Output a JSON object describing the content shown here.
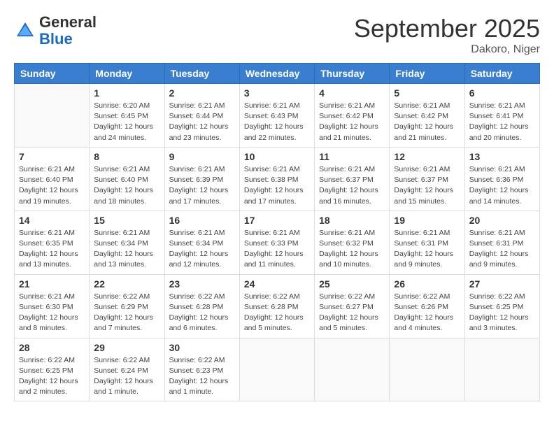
{
  "header": {
    "logo_general": "General",
    "logo_blue": "Blue",
    "month_title": "September 2025",
    "location": "Dakoro, Niger"
  },
  "days_of_week": [
    "Sunday",
    "Monday",
    "Tuesday",
    "Wednesday",
    "Thursday",
    "Friday",
    "Saturday"
  ],
  "weeks": [
    [
      {
        "day": "",
        "info": ""
      },
      {
        "day": "1",
        "info": "Sunrise: 6:20 AM\nSunset: 6:45 PM\nDaylight: 12 hours and 24 minutes."
      },
      {
        "day": "2",
        "info": "Sunrise: 6:21 AM\nSunset: 6:44 PM\nDaylight: 12 hours and 23 minutes."
      },
      {
        "day": "3",
        "info": "Sunrise: 6:21 AM\nSunset: 6:43 PM\nDaylight: 12 hours and 22 minutes."
      },
      {
        "day": "4",
        "info": "Sunrise: 6:21 AM\nSunset: 6:42 PM\nDaylight: 12 hours and 21 minutes."
      },
      {
        "day": "5",
        "info": "Sunrise: 6:21 AM\nSunset: 6:42 PM\nDaylight: 12 hours and 21 minutes."
      },
      {
        "day": "6",
        "info": "Sunrise: 6:21 AM\nSunset: 6:41 PM\nDaylight: 12 hours and 20 minutes."
      }
    ],
    [
      {
        "day": "7",
        "info": "Sunrise: 6:21 AM\nSunset: 6:40 PM\nDaylight: 12 hours and 19 minutes."
      },
      {
        "day": "8",
        "info": "Sunrise: 6:21 AM\nSunset: 6:40 PM\nDaylight: 12 hours and 18 minutes."
      },
      {
        "day": "9",
        "info": "Sunrise: 6:21 AM\nSunset: 6:39 PM\nDaylight: 12 hours and 17 minutes."
      },
      {
        "day": "10",
        "info": "Sunrise: 6:21 AM\nSunset: 6:38 PM\nDaylight: 12 hours and 17 minutes."
      },
      {
        "day": "11",
        "info": "Sunrise: 6:21 AM\nSunset: 6:37 PM\nDaylight: 12 hours and 16 minutes."
      },
      {
        "day": "12",
        "info": "Sunrise: 6:21 AM\nSunset: 6:37 PM\nDaylight: 12 hours and 15 minutes."
      },
      {
        "day": "13",
        "info": "Sunrise: 6:21 AM\nSunset: 6:36 PM\nDaylight: 12 hours and 14 minutes."
      }
    ],
    [
      {
        "day": "14",
        "info": "Sunrise: 6:21 AM\nSunset: 6:35 PM\nDaylight: 12 hours and 13 minutes."
      },
      {
        "day": "15",
        "info": "Sunrise: 6:21 AM\nSunset: 6:34 PM\nDaylight: 12 hours and 13 minutes."
      },
      {
        "day": "16",
        "info": "Sunrise: 6:21 AM\nSunset: 6:34 PM\nDaylight: 12 hours and 12 minutes."
      },
      {
        "day": "17",
        "info": "Sunrise: 6:21 AM\nSunset: 6:33 PM\nDaylight: 12 hours and 11 minutes."
      },
      {
        "day": "18",
        "info": "Sunrise: 6:21 AM\nSunset: 6:32 PM\nDaylight: 12 hours and 10 minutes."
      },
      {
        "day": "19",
        "info": "Sunrise: 6:21 AM\nSunset: 6:31 PM\nDaylight: 12 hours and 9 minutes."
      },
      {
        "day": "20",
        "info": "Sunrise: 6:21 AM\nSunset: 6:31 PM\nDaylight: 12 hours and 9 minutes."
      }
    ],
    [
      {
        "day": "21",
        "info": "Sunrise: 6:21 AM\nSunset: 6:30 PM\nDaylight: 12 hours and 8 minutes."
      },
      {
        "day": "22",
        "info": "Sunrise: 6:22 AM\nSunset: 6:29 PM\nDaylight: 12 hours and 7 minutes."
      },
      {
        "day": "23",
        "info": "Sunrise: 6:22 AM\nSunset: 6:28 PM\nDaylight: 12 hours and 6 minutes."
      },
      {
        "day": "24",
        "info": "Sunrise: 6:22 AM\nSunset: 6:28 PM\nDaylight: 12 hours and 5 minutes."
      },
      {
        "day": "25",
        "info": "Sunrise: 6:22 AM\nSunset: 6:27 PM\nDaylight: 12 hours and 5 minutes."
      },
      {
        "day": "26",
        "info": "Sunrise: 6:22 AM\nSunset: 6:26 PM\nDaylight: 12 hours and 4 minutes."
      },
      {
        "day": "27",
        "info": "Sunrise: 6:22 AM\nSunset: 6:25 PM\nDaylight: 12 hours and 3 minutes."
      }
    ],
    [
      {
        "day": "28",
        "info": "Sunrise: 6:22 AM\nSunset: 6:25 PM\nDaylight: 12 hours and 2 minutes."
      },
      {
        "day": "29",
        "info": "Sunrise: 6:22 AM\nSunset: 6:24 PM\nDaylight: 12 hours and 1 minute."
      },
      {
        "day": "30",
        "info": "Sunrise: 6:22 AM\nSunset: 6:23 PM\nDaylight: 12 hours and 1 minute."
      },
      {
        "day": "",
        "info": ""
      },
      {
        "day": "",
        "info": ""
      },
      {
        "day": "",
        "info": ""
      },
      {
        "day": "",
        "info": ""
      }
    ]
  ]
}
